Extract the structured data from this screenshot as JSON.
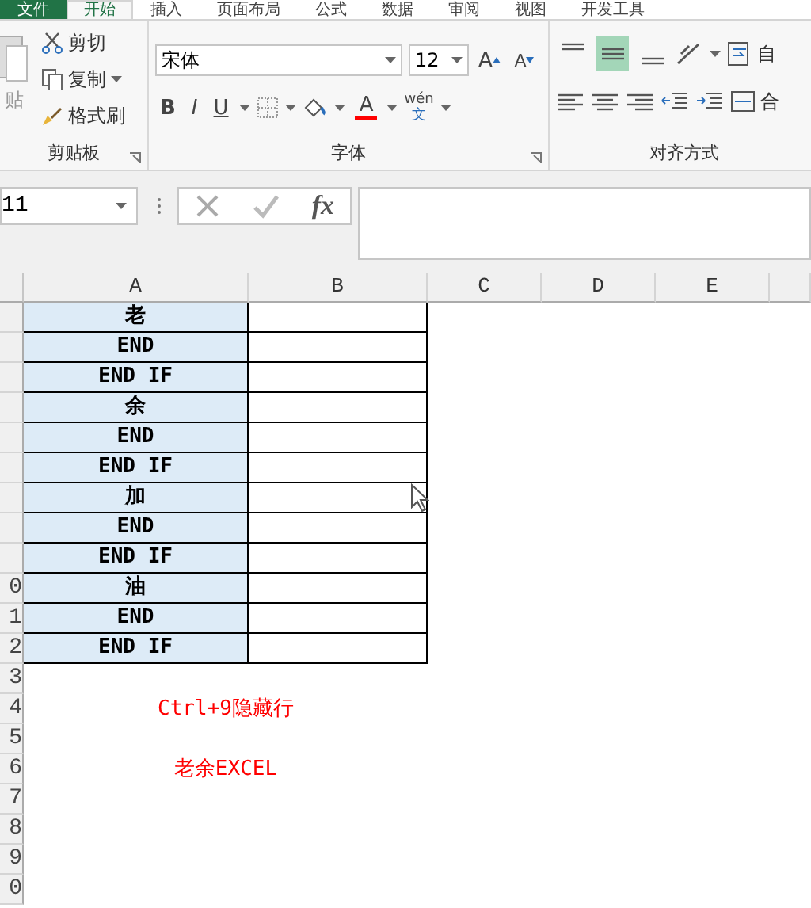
{
  "ribbon_tabs": [
    {
      "label": "文件",
      "kind": "file",
      "selected": false
    },
    {
      "label": "开始",
      "kind": "tab",
      "selected": true
    },
    {
      "label": "插入",
      "kind": "tab",
      "selected": false
    },
    {
      "label": "页面布局",
      "kind": "tab",
      "selected": false
    },
    {
      "label": "公式",
      "kind": "tab",
      "selected": false
    },
    {
      "label": "数据",
      "kind": "tab",
      "selected": false
    },
    {
      "label": "审阅",
      "kind": "tab",
      "selected": false
    },
    {
      "label": "视图",
      "kind": "tab",
      "selected": false
    },
    {
      "label": "开发工具",
      "kind": "tab",
      "selected": false
    }
  ],
  "clipboard": {
    "paste": "贴",
    "cut": "剪切",
    "copy": "复制",
    "format_painter": "格式刷",
    "label": "剪贴板"
  },
  "font": {
    "name": "宋体",
    "size": "12",
    "grow": "A",
    "shrink": "A",
    "bold": "B",
    "italic": "I",
    "underline": "U",
    "color_letter": "A",
    "phonetic": "wén",
    "phonetic_char": "文",
    "label": "字体"
  },
  "alignment": {
    "vertical": [
      {
        "selected": false
      },
      {
        "selected": true
      },
      {
        "selected": false
      }
    ],
    "wrap": "自",
    "merge": "合",
    "label": "对齐方式"
  },
  "name_box": "11",
  "formula_bar": {
    "fx": "fx"
  },
  "columns": [
    "A",
    "B",
    "C",
    "D",
    "E"
  ],
  "rows": [
    {
      "a": "老"
    },
    {
      "a": "END"
    },
    {
      "a": "END IF"
    },
    {
      "a": "余"
    },
    {
      "a": "END"
    },
    {
      "a": "END IF"
    },
    {
      "a": "加"
    },
    {
      "a": "END"
    },
    {
      "a": "END IF"
    },
    {
      "number": "0",
      "a": "油"
    },
    {
      "number": "1",
      "a": "END"
    },
    {
      "number": "2",
      "a": "END IF"
    },
    {
      "number": "3"
    },
    {
      "number": "4",
      "note": "Ctrl+9隐藏行"
    },
    {
      "number": "5"
    },
    {
      "number": "6",
      "note": "老余EXCEL"
    },
    {
      "number": "7"
    },
    {
      "number": "8"
    },
    {
      "number": "9"
    },
    {
      "number": "0"
    }
  ]
}
